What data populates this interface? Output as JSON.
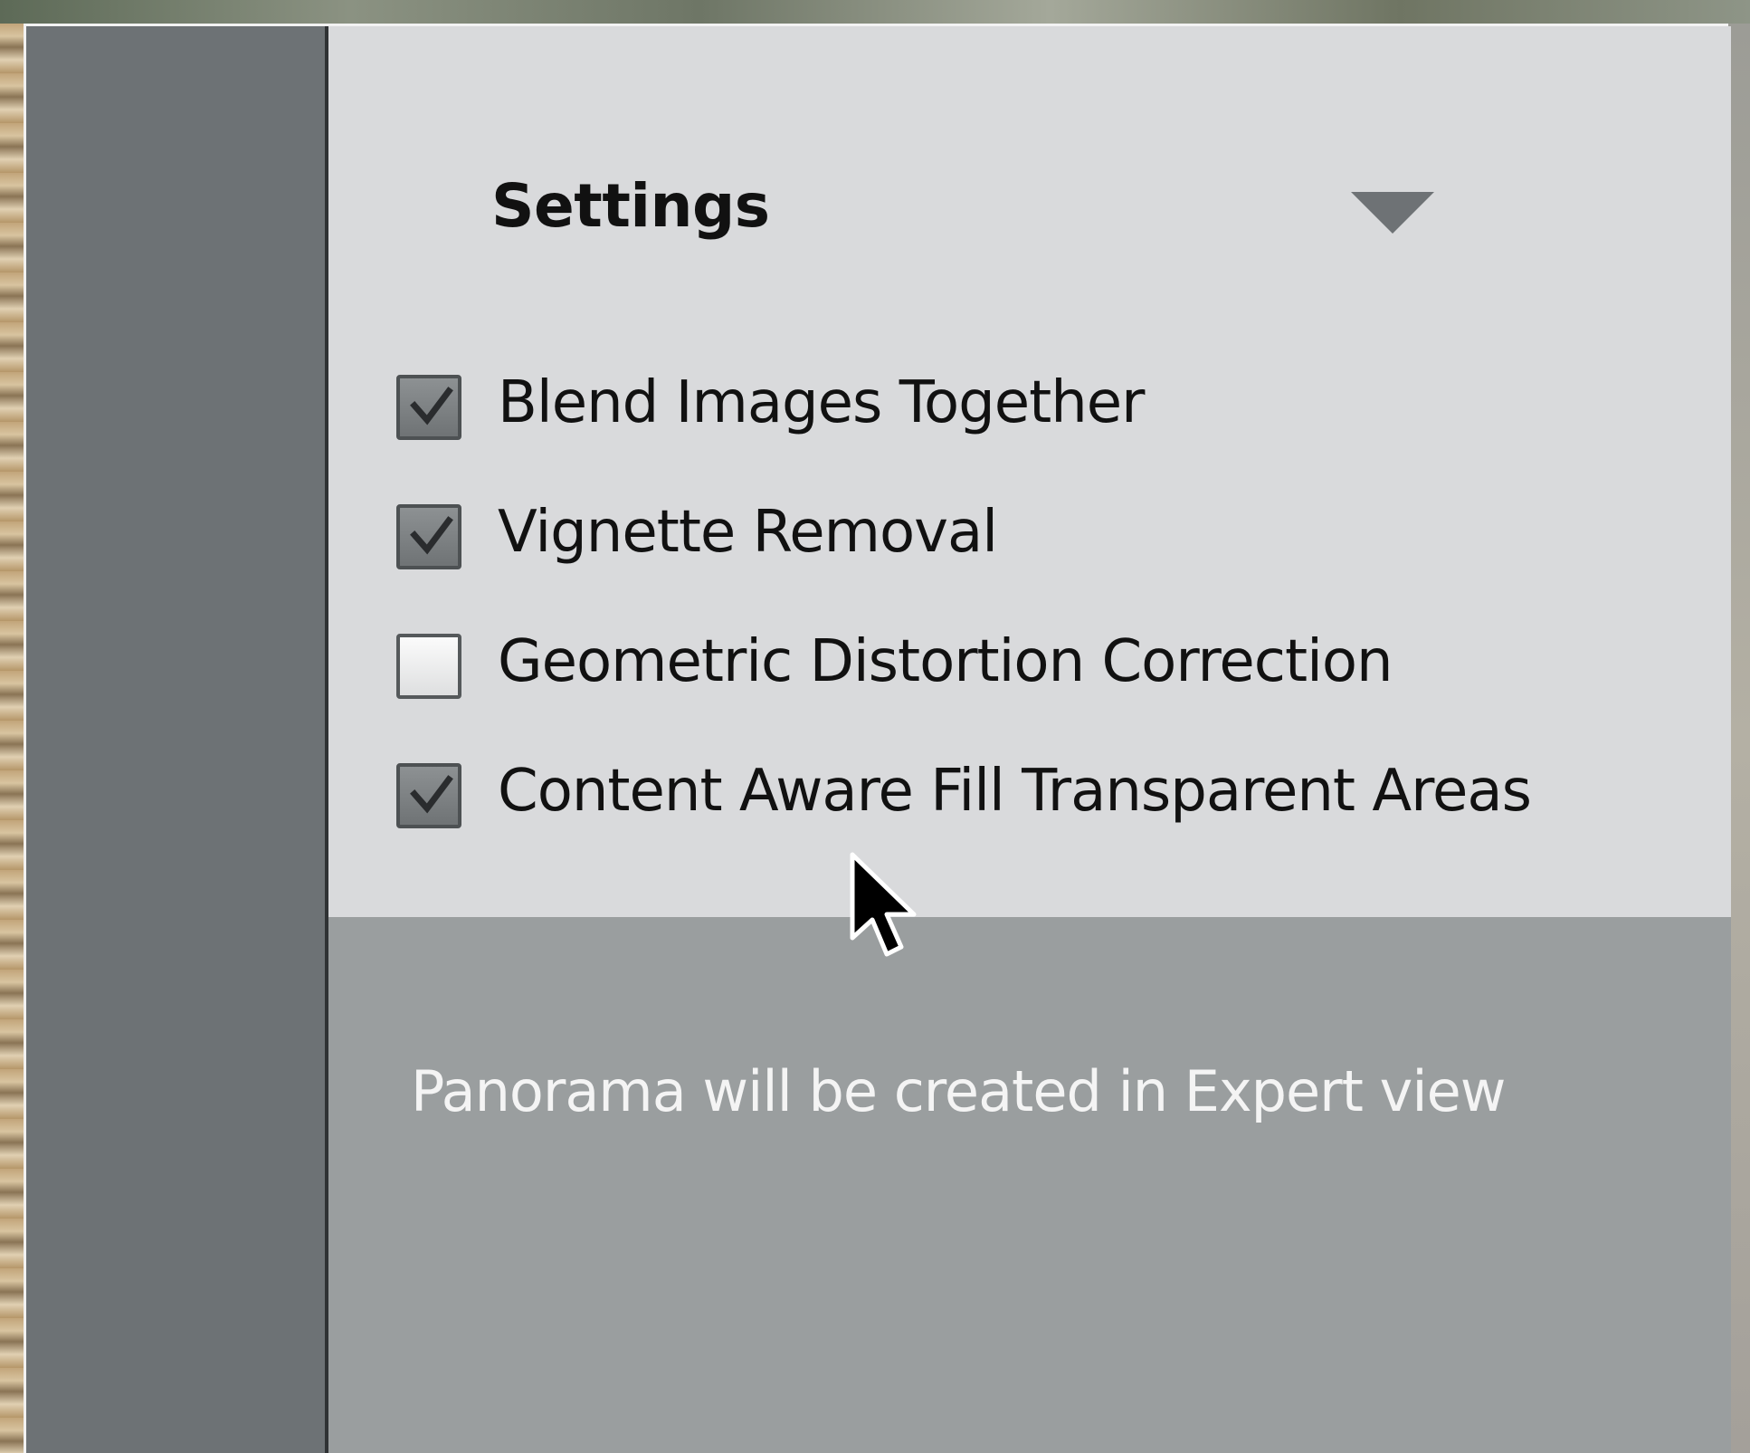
{
  "settings": {
    "title": "Settings",
    "toggle_icon": "chevron-down-icon",
    "options": [
      {
        "label": "Blend Images Together",
        "checked": true
      },
      {
        "label": "Vignette Removal",
        "checked": true
      },
      {
        "label": "Geometric Distortion Correction",
        "checked": false
      },
      {
        "label": "Content Aware Fill Transparent Areas",
        "checked": true
      }
    ]
  },
  "footer": {
    "note": "Panorama will be created in Expert view"
  },
  "colors": {
    "panel_background": "#d9dadc",
    "footer_background": "#9a9e9f",
    "left_rail": "#6d7275"
  }
}
